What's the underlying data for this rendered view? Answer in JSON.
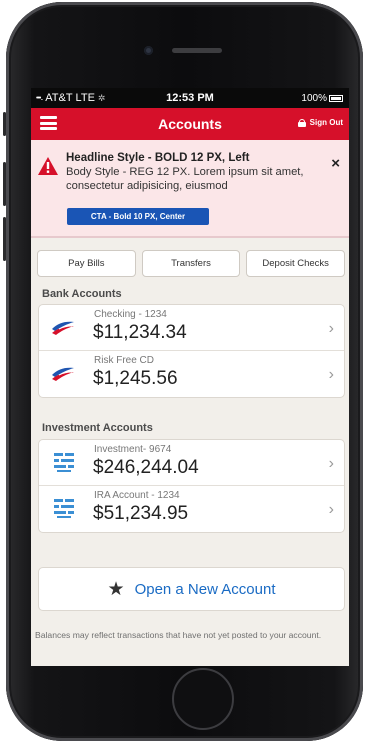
{
  "status_bar": {
    "carrier": "AT&T",
    "network": "LTE",
    "time": "12:53 PM",
    "battery": "100%"
  },
  "nav": {
    "title": "Accounts",
    "sign_out": "Sign Out"
  },
  "alert": {
    "headline": "Headline Style - BOLD 12 PX, Left",
    "body": "Body Style - REG 12 PX. Lorem ipsum sit amet, consectetur adipisicing, eiusmod",
    "cta": "CTA - Bold 10 PX, Center",
    "close": "×"
  },
  "quick_actions": [
    {
      "label": "Pay Bills"
    },
    {
      "label": "Transfers"
    },
    {
      "label": "Deposit Checks"
    }
  ],
  "bank_accounts": {
    "header": "Bank Accounts",
    "items": [
      {
        "name": "Checking - 1234",
        "balance": "$11,234.34"
      },
      {
        "name": "Risk Free CD",
        "balance": "$1,245.56"
      }
    ]
  },
  "investment_accounts": {
    "header": "Investment Accounts",
    "items": [
      {
        "name": "Investment- 9674",
        "balance": "$246,244.04"
      },
      {
        "name": "IRA Account - 1234",
        "balance": "$51,234.95"
      }
    ]
  },
  "open_account": {
    "label": "Open a New Account"
  },
  "disclaimer": "Balances may reflect transactions that have not yet posted to your account.",
  "colors": {
    "brand_red": "#d6102a",
    "cta_blue": "#1a55b5",
    "link_blue": "#1a6bc4",
    "alert_bg": "#fbe6e8"
  },
  "icons": {
    "menu": "hamburger-icon",
    "lock": "lock-icon",
    "alert": "warning-icon",
    "bank": "boa-flag-icon",
    "investment": "merrill-edge-icon",
    "add": "star-icon"
  }
}
